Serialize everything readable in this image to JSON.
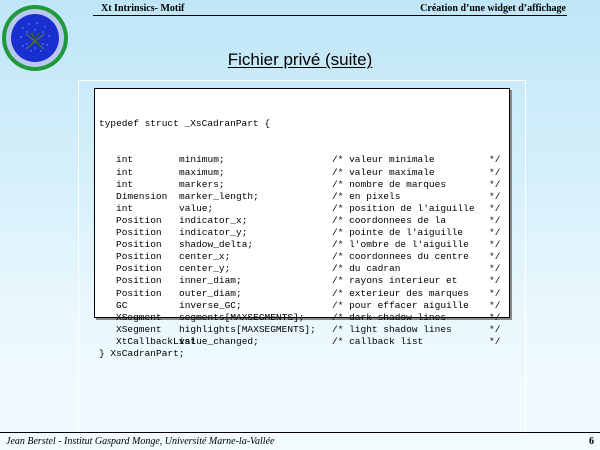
{
  "header": {
    "left": "Xt Intrinsics- Motif",
    "right": "Création d’une widget d’affichage"
  },
  "logo": {
    "text": "X",
    "icon": "xt-logo-icon"
  },
  "slide": {
    "title": "Fichier privé (suite)"
  },
  "code": {
    "open_line": "typedef struct _XsCadranPart {",
    "fields": [
      {
        "type": "int",
        "name": "minimum;",
        "comment": "/* valeur minimale",
        "end": "*/"
      },
      {
        "type": "int",
        "name": "maximum;",
        "comment": "/* valeur maximale",
        "end": "*/"
      },
      {
        "type": "int",
        "name": "markers;",
        "comment": "/* nombre de marques",
        "end": "*/"
      },
      {
        "type": "Dimension",
        "name": "marker_length;",
        "comment": "/* en pixels",
        "end": "*/"
      },
      {
        "type": "int",
        "name": "value;",
        "comment": "/* position de l'aiguille",
        "end": "*/"
      },
      {
        "type": "Position",
        "name": "indicator_x;",
        "comment": "/* coordonnees de la",
        "end": "*/"
      },
      {
        "type": "Position",
        "name": "indicator_y;",
        "comment": "/* pointe de l'aiguille",
        "end": "*/"
      },
      {
        "type": "Position",
        "name": "shadow_delta;",
        "comment": "/* l'ombre de l'aiguille",
        "end": "*/"
      },
      {
        "type": "Position",
        "name": "center_x;",
        "comment": "/* coordonnees du centre",
        "end": "*/"
      },
      {
        "type": "Position",
        "name": "center_y;",
        "comment": "/* du cadran",
        "end": "*/"
      },
      {
        "type": "Position",
        "name": "inner_diam;",
        "comment": "/* rayons interieur et",
        "end": "*/"
      },
      {
        "type": "Position",
        "name": "outer_diam;",
        "comment": "/* exterieur des marques",
        "end": "*/"
      },
      {
        "type": "GC",
        "name": "inverse_GC;",
        "comment": "/* pour effacer aiguille",
        "end": "*/"
      },
      {
        "type": "XSegment",
        "name": "segments[MAXSEGMENTS];",
        "comment": "/* dark shadow lines",
        "end": "*/"
      },
      {
        "type": "XSegment",
        "name": "highlights[MAXSEGMENTS];",
        "comment": "/* light shadow lines",
        "end": "*/"
      },
      {
        "type": "XtCallbackList",
        "name": "value_changed;",
        "comment": "/* callback list",
        "end": "*/"
      }
    ],
    "close_line": "} XsCadranPart;"
  },
  "footer": {
    "left": "Jean Berstel  -   Institut Gaspard Monge, Université Marne-la-Vallée",
    "page": "6"
  },
  "colors": {
    "background_top": "#bfe6f7",
    "logo_outer": "#1e9a3a",
    "logo_inner": "#1a2fd0"
  }
}
